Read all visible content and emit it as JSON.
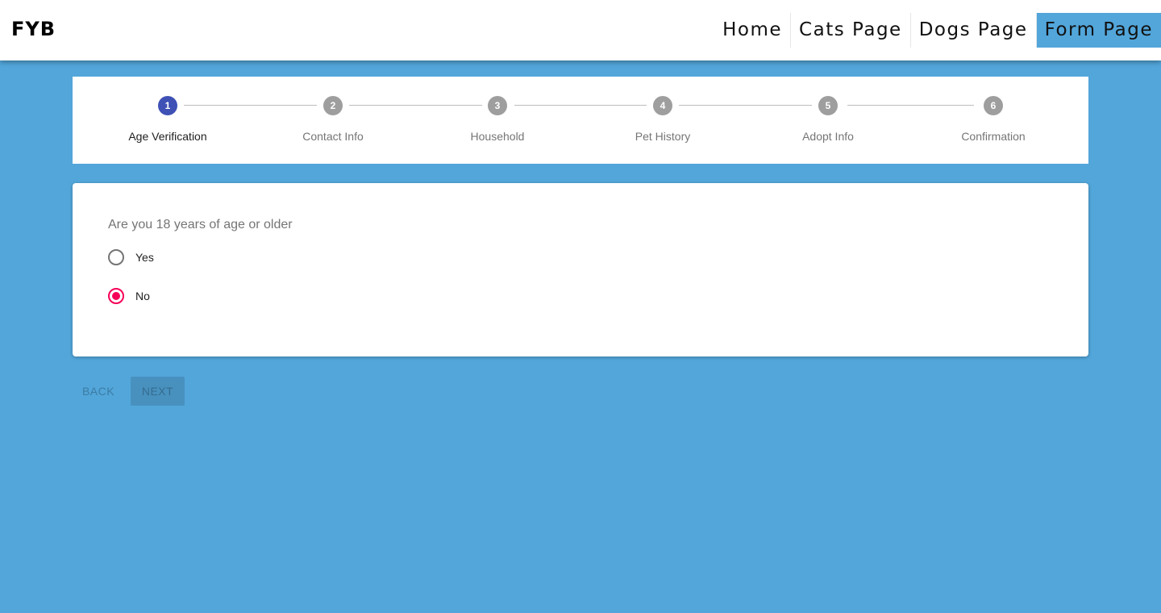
{
  "header": {
    "brand": "FYB",
    "nav": [
      {
        "label": "Home"
      },
      {
        "label": "Cats Page"
      },
      {
        "label": "Dogs Page"
      },
      {
        "label": "Form Page",
        "active": true
      }
    ]
  },
  "stepper": {
    "steps": [
      {
        "number": "1",
        "label": "Age Verification",
        "active": true
      },
      {
        "number": "2",
        "label": "Contact Info"
      },
      {
        "number": "3",
        "label": "Household"
      },
      {
        "number": "4",
        "label": "Pet History"
      },
      {
        "number": "5",
        "label": "Adopt Info"
      },
      {
        "number": "6",
        "label": "Confirmation"
      }
    ]
  },
  "form": {
    "question": "Are you 18 years of age or older",
    "options": [
      {
        "label": "Yes",
        "checked": false
      },
      {
        "label": "No",
        "checked": true
      }
    ]
  },
  "actions": {
    "back_label": "Back",
    "next_label": "Next"
  },
  "colors": {
    "background": "#52a6da",
    "active_step": "#3f51b5",
    "inactive_step": "#9e9e9e",
    "radio_checked": "#f50057"
  }
}
